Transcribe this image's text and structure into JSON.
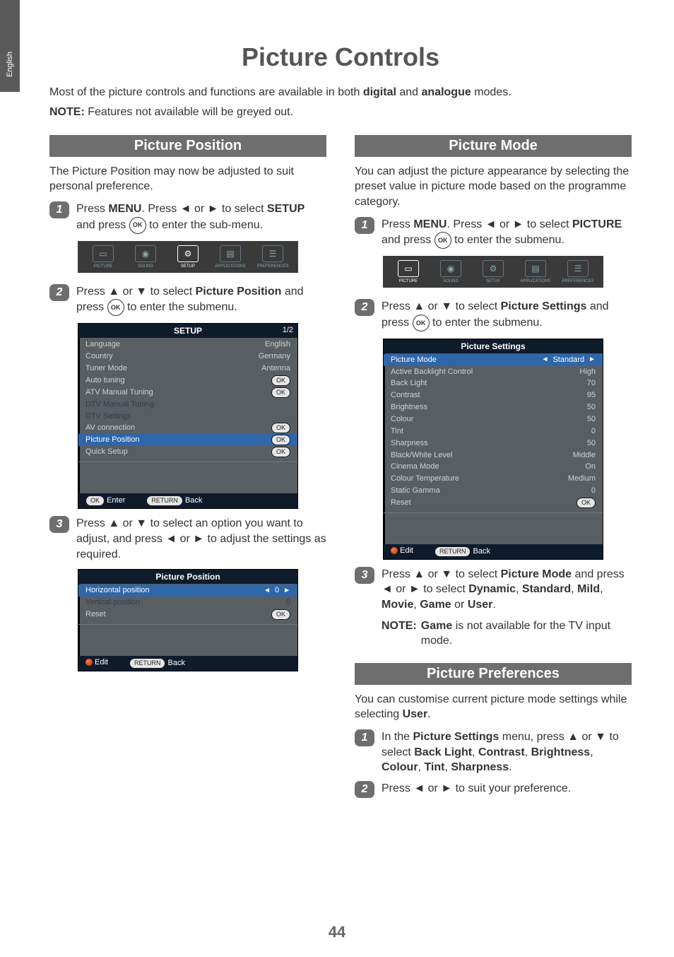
{
  "sideTab": "English",
  "title": "Picture Controls",
  "intro1_a": "Most of the picture controls and functions are available in both ",
  "intro1_b": "digital",
  "intro1_c": " and ",
  "intro1_d": "analogue",
  "intro1_e": " modes.",
  "intro2_a": "NOTE:",
  "intro2_b": " Features not available will be greyed out.",
  "pageNumber": "44",
  "left": {
    "header": "Picture Position",
    "p1": "The Picture Position may now be adjusted to suit personal preference.",
    "step1_a": "Press ",
    "step1_b": "MENU",
    "step1_c": ". Press ◄ or ► to select ",
    "step1_d": "SETUP",
    "step1_e": " and press ",
    "step1_f": " to enter the sub-menu.",
    "step2_a": "Press ▲ or ▼ to select ",
    "step2_b": "Picture Position",
    "step2_c": " and press ",
    "step2_d": " to enter the submenu.",
    "step3": "Press ▲ or ▼ to select an option you want to adjust, and press ◄ or ► to adjust the settings as required.",
    "menuStrip": {
      "items": [
        "PICTURE",
        "SOUND",
        "SETUP",
        "APPLICATIONS",
        "PREFERENCES"
      ],
      "selectedIndex": 2
    },
    "setupPanel": {
      "title": "SETUP",
      "page": "1/2",
      "rows": [
        {
          "label": "Language",
          "value": "English"
        },
        {
          "label": "Country",
          "value": "Germany"
        },
        {
          "label": "Tuner Mode",
          "value": "Antenna"
        },
        {
          "label": "Auto tuning",
          "value": "OK",
          "pill": true
        },
        {
          "label": "ATV Manual Tuning",
          "value": "OK",
          "pill": true
        },
        {
          "label": "DTV Manual Tuning",
          "value": "",
          "dim": true
        },
        {
          "label": "DTV Settings",
          "value": "",
          "dim": true
        },
        {
          "label": "AV connection",
          "value": "OK",
          "pill": true
        },
        {
          "label": "Picture Position",
          "value": "OK",
          "pill": true,
          "sel": true
        },
        {
          "label": "Quick Setup",
          "value": "OK",
          "pill": true
        }
      ],
      "footEnterPill": "OK",
      "footEnter": "Enter",
      "footBackPill": "RETURN",
      "footBack": "Back"
    },
    "posPanel": {
      "title": "Picture Position",
      "rows": [
        {
          "label": "Horizontal position",
          "value": "0",
          "sel": true,
          "arrows": true
        },
        {
          "label": "Vertical position",
          "value": "0",
          "dim": true
        },
        {
          "label": "Reset",
          "value": "OK",
          "pill": true
        }
      ],
      "footEditPill": "",
      "footEdit": "Edit",
      "footBackPill": "RETURN",
      "footBack": "Back"
    }
  },
  "right": {
    "header": "Picture Mode",
    "p1": "You can adjust the picture appearance by selecting the preset value in picture mode based on the programme category.",
    "step1_a": "Press ",
    "step1_b": "MENU",
    "step1_c": ". Press ◄ or ► to select ",
    "step1_d": "PICTURE",
    "step1_e": " and press ",
    "step1_f": " to enter the submenu.",
    "step2_a": "Press ▲ or ▼ to select ",
    "step2_b": "Picture Settings",
    "step2_c": " and press ",
    "step2_d": " to enter the submenu.",
    "step3_a": "Press ▲ or ▼ to select ",
    "step3_b": "Picture Mode",
    "step3_c": " and press ◄ or ► to select ",
    "step3_d": "Dynamic",
    "step3_e": ", ",
    "step3_f": "Standard",
    "step3_g": ", ",
    "step3_h": "Mild",
    "step3_i": ", ",
    "step3_j": "Movie",
    "step3_k": ", ",
    "step3_l": "Game",
    "step3_m": " or ",
    "step3_n": "User",
    "step3_o": ".",
    "note_a": "NOTE:",
    "note_b": "Game",
    "note_c": " is not available for the TV input mode.",
    "menuStrip": {
      "items": [
        "PICTURE",
        "SOUND",
        "SETUP",
        "APPLICATIONS",
        "PREFERENCES"
      ],
      "selectedIndex": 0
    },
    "settingsPanel": {
      "title": "Picture Settings",
      "rows": [
        {
          "label": "Picture Mode",
          "value": "Standard",
          "sel": true,
          "arrows": true
        },
        {
          "label": "Active Backlight Control",
          "value": "High"
        },
        {
          "label": "Back Light",
          "value": "70"
        },
        {
          "label": "Contrast",
          "value": "95"
        },
        {
          "label": "Brightness",
          "value": "50"
        },
        {
          "label": "Colour",
          "value": "50"
        },
        {
          "label": "Tint",
          "value": "0"
        },
        {
          "label": "Sharpness",
          "value": "50"
        },
        {
          "label": "Black/White Level",
          "value": "Middle"
        },
        {
          "label": "Cinema Mode",
          "value": "On"
        },
        {
          "label": "Colour Temperature",
          "value": "Medium"
        },
        {
          "label": "Static Gamma",
          "value": "0"
        },
        {
          "label": "Reset",
          "value": "OK",
          "pill": true
        }
      ],
      "footEdit": "Edit",
      "footBackPill": "RETURN",
      "footBack": "Back"
    },
    "prefHeader": "Picture Preferences",
    "prefP1_a": "You can customise current picture mode settings while selecting ",
    "prefP1_b": "User",
    "prefP1_c": ".",
    "prefStep1_a": "In the ",
    "prefStep1_b": "Picture Settings",
    "prefStep1_c": " menu, press ▲ or ▼ to select ",
    "prefStep1_d": "Back Light",
    "prefStep1_e": ", ",
    "prefStep1_f": "Contrast",
    "prefStep1_g": ", ",
    "prefStep1_h": "Brightness",
    "prefStep1_i": ", ",
    "prefStep1_j": "Colour",
    "prefStep1_k": ", ",
    "prefStep1_l": "Tint",
    "prefStep1_m": ", ",
    "prefStep1_n": "Sharpness",
    "prefStep1_o": ".",
    "prefStep2": "Press ◄ or ► to suit your preference."
  },
  "okLabel": "OK"
}
